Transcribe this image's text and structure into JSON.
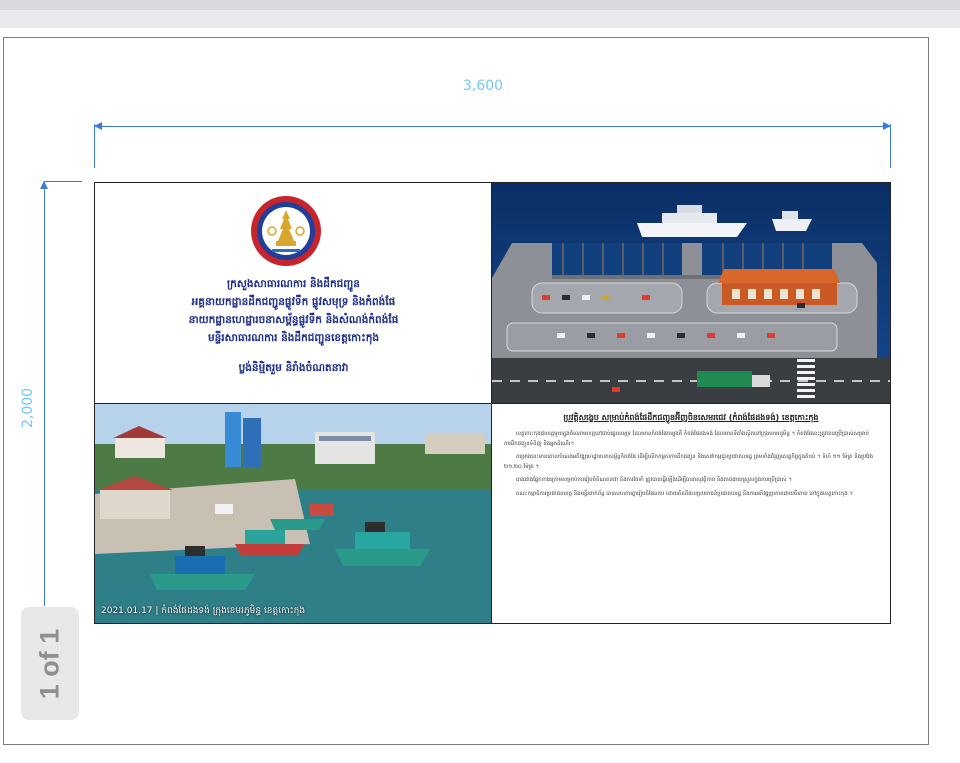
{
  "document": {
    "width_label": "3,600",
    "height_label": "2,000",
    "page_indicator": "1 of 1"
  },
  "panel_top_left": {
    "logo_icon": "ministry-logo-icon",
    "lines": [
      "ក្រសួងសាធារណការ និងដឹកជញ្ជូន",
      "អគ្គនាយកដ្ឋានដឹកជញ្ជូនផ្លូវទឹក ផ្លូវសមុទ្រ និងកំពង់ផែ",
      "នាយកដ្ឋានហេដ្ឋារចនាសម្ព័ន្ធផ្លូវទឹក និងសំណង់កំពង់ផែ",
      "មន្ទីរសាធារណការ និងដឹកជញ្ជូនខេត្តកោះកុង"
    ],
    "subtitle": "ប្លង់និម្មិតរួម និរាំងចំណតនាវា"
  },
  "panel_bottom_left": {
    "caption": "2021.01.17 | កំពង់ផែដងទង់ ក្រុងខេមរភូមិន្ទ ខេត្តកោះកុង"
  },
  "panel_bottom_right": {
    "title": "ប្រវត្តិសង្ខេប សម្រាប់កំពង់ផែដឹកជញ្ជូនអ៊ីញចិនសេមរជេវ (កំពង់ផែដងទង់) ខេត្តកោះកុង",
    "paragraphs": [
      "ខេត្តកោះកុងជាខេត្តមួយក្នុងចំណោមខេត្តនៅជាប់ឆ្នេរសមុទ្រ ដែលមានកំពង់ផែចម្បងគឺ កំពង់ផែដងទង់ ដែលមានទីតាំងស្ថិតនៅក្រុងខេមរភូមិន្ទ ។ កំពង់ផែនេះត្រូវបានប្រើប្រាស់សម្រាប់ការដឹកជញ្ជូនទំនិញ និងអ្នកដំណើរ។",
      "គម្រោងនេះមានគោលបំណងអភិវឌ្ឍហេដ្ឋារចនាសម្ព័ន្ធកំពង់ផែ ដើម្បីលើកកម្ពស់ការដឹកជញ្ជូន និងសេវាកម្មជូនប្រជាពលរដ្ឋ ព្រមទាំងជំរុញសេដ្ឋកិច្ចក្នុងតំបន់ ។ ទំហំ ១១ ម៉ែត្រ និងប្រវែង ២១.២០ ម៉ែត្រ ។",
      "រោងជាងផ្នែកខាងក្រោមសម្រាប់ការរៀបចំចំណតនាវា និងការថែទាំ ត្រូវបានធ្វើឡើងដើម្បីធានាសុវត្ថិភាព និងភាពងាយស្រួលក្នុងការប្រើប្រាស់ ។",
      "គណៈកម្មាធិការប្រជាជនខេត្ត និងមន្ទីរពាក់ព័ន្ធ បានសហការគ្នារៀបចំផែនការ ដោយគិតពីផលប្រយោជន៍ប្រជាពលរដ្ឋ និងការអភិវឌ្ឍប្រកបដោយចីរភាព នៅក្នុងខេត្តកោះកុង ។"
    ]
  },
  "colors": {
    "dimension_line": "#3b7ad9",
    "dimension_label": "#73c7f1",
    "ministry_text": "#1b2c8a"
  }
}
